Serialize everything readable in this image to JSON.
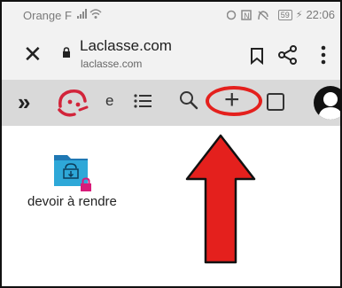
{
  "status_bar": {
    "carrier": "Orange F",
    "battery": "59",
    "time": "22:06"
  },
  "browser": {
    "title": "Laclasse.com",
    "url": "laclasse.com",
    "icons": [
      "close-icon",
      "lock-icon",
      "bookmark-icon",
      "share-icon",
      "more-vertical-icon"
    ]
  },
  "toolbar": {
    "e_label": "e",
    "plus_label": "+",
    "icons": [
      "chevron-double-right-icon",
      "laclasse-logo",
      "list-icon",
      "search-icon",
      "plus-icon",
      "square-icon",
      "avatar-icon"
    ]
  },
  "content": {
    "items": [
      {
        "label": "devoir à rendre",
        "icon": "locked-folder-icon"
      }
    ]
  },
  "annotation": {
    "color": "#e4201d",
    "shapes": [
      "ellipse",
      "up-arrow"
    ]
  }
}
